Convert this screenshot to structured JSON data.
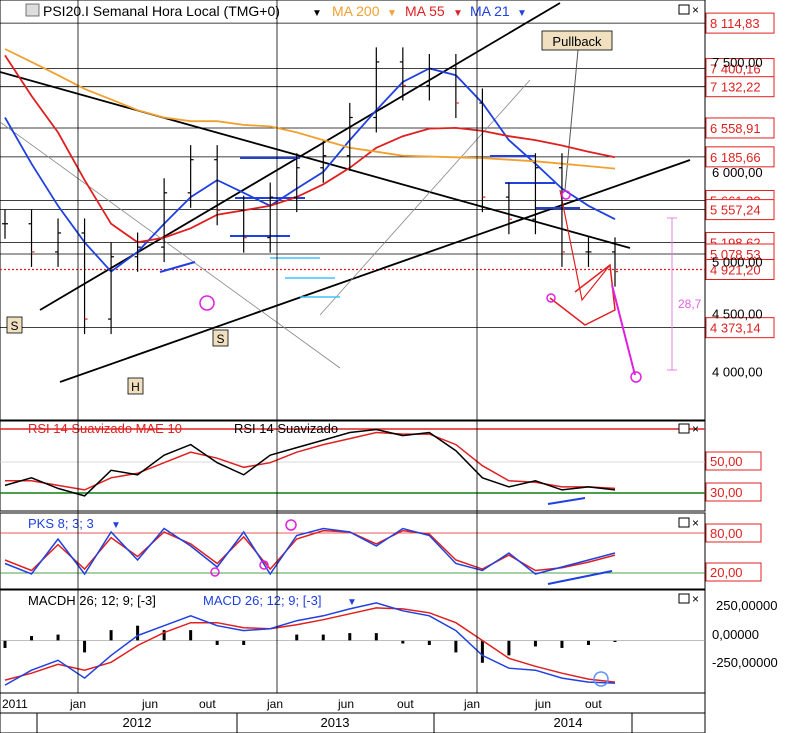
{
  "header": {
    "title": "PSI20.I Semanal Hora Local (TMG+0)",
    "ma200": "MA 200",
    "ma55": "MA 55",
    "ma21": "MA 21",
    "pullback": "Pullback",
    "pattern_labels": [
      "S",
      "S",
      "H"
    ],
    "fib_label": "28,7",
    "colors": {
      "ma200": "#f0a030",
      "ma55": "#e02020",
      "ma21": "#2040e0"
    }
  },
  "price_axis": {
    "ticks": [
      "7 500,00",
      "6 000,00",
      "5 000,00",
      "4 500,00",
      "4 000,00"
    ],
    "boxes": [
      {
        "label": "8 114,83",
        "value": 8114.83
      },
      {
        "label": "7 400,16",
        "value": 7400.16
      },
      {
        "label": "7 132,22",
        "value": 7132.22
      },
      {
        "label": "6 558,91",
        "value": 6558.91
      },
      {
        "label": "6 185,66",
        "value": 6185.66
      },
      {
        "label": "5 661,33",
        "value": 5661.33
      },
      {
        "label": "5 557,24",
        "value": 5557.24
      },
      {
        "label": "5 198,62",
        "value": 5198.62
      },
      {
        "label": "5 078,53",
        "value": 5078.53
      },
      {
        "label": "4 921,20",
        "value": 4921.2
      },
      {
        "label": "4 373,14",
        "value": 4373.14
      }
    ]
  },
  "rsi_panel": {
    "title": "RSI 14 Suavizado MAE 10",
    "title2": "RSI 14 Suavizado",
    "ticks": [
      "50,00",
      "30,00"
    ]
  },
  "pks_panel": {
    "title": "PKS 8; 3; 3",
    "ticks": [
      "80,00",
      "20,00"
    ]
  },
  "macd_panel": {
    "title": "MACDH 26; 12; 9; [-3]",
    "title2": "MACD 26; 12; 9; [-3]",
    "ticks": [
      "250,00000",
      "0,00000",
      "-250,00000"
    ]
  },
  "time_axis": {
    "months": [
      "2011",
      "jan",
      "jun",
      "out",
      "jan",
      "jun",
      "out",
      "jan",
      "jun",
      "out"
    ],
    "years": [
      "2012",
      "2013",
      "2014"
    ]
  },
  "chart_data": {
    "type": "line",
    "x": [
      "2011-10",
      "2012-01",
      "2012-03",
      "2012-06",
      "2012-08",
      "2012-10",
      "2012-12",
      "2013-02",
      "2013-04",
      "2013-06",
      "2013-07",
      "2013-09",
      "2013-11",
      "2014-01",
      "2014-02",
      "2014-03",
      "2014-04",
      "2014-05",
      "2014-06",
      "2014-07",
      "2014-08",
      "2014-09",
      "2014-10",
      "2014-11"
    ],
    "series": [
      {
        "name": "PSI20.I",
        "values": [
          5400,
          5100,
          5300,
          4450,
          5050,
          5150,
          5750,
          6150,
          5550,
          5250,
          5700,
          6050,
          6200,
          6700,
          7500,
          7150,
          7400,
          6900,
          5700,
          5450,
          6050,
          5100,
          5100,
          4900
        ]
      },
      {
        "name": "MA 21",
        "values": [
          6700,
          6100,
          5600,
          5200,
          4900,
          5100,
          5400,
          5700,
          5900,
          5750,
          5600,
          5800,
          6000,
          6400,
          6800,
          7200,
          7400,
          7300,
          6900,
          6400,
          6100,
          5800,
          5600,
          5450
        ]
      },
      {
        "name": "MA 55",
        "values": [
          7600,
          7000,
          6500,
          5900,
          5400,
          5200,
          5250,
          5350,
          5500,
          5550,
          5600,
          5700,
          5850,
          6050,
          6300,
          6450,
          6550,
          6560,
          6520,
          6450,
          6400,
          6330,
          6250,
          6180
        ]
      },
      {
        "name": "MA 200",
        "values": [
          7700,
          7500,
          7300,
          7100,
          6950,
          6800,
          6700,
          6650,
          6650,
          6600,
          6580,
          6500,
          6400,
          6300,
          6250,
          6200,
          6190,
          6180,
          6170,
          6150,
          6130,
          6100,
          6070,
          6040
        ]
      }
    ],
    "ylim": [
      3700,
      8300
    ],
    "indicators": {
      "rsi": [
        35,
        40,
        33,
        28,
        45,
        42,
        55,
        62,
        50,
        42,
        55,
        60,
        65,
        70,
        72,
        68,
        70,
        58,
        40,
        34,
        38,
        32,
        34,
        32
      ],
      "rsi_signal": [
        38,
        38,
        35,
        32,
        40,
        43,
        50,
        57,
        53,
        47,
        50,
        57,
        62,
        66,
        70,
        69,
        69,
        62,
        48,
        38,
        37,
        34,
        34,
        33
      ],
      "rsi_ylim": [
        20,
        75
      ],
      "pks": [
        35,
        20,
        70,
        20,
        80,
        40,
        85,
        60,
        30,
        80,
        20,
        75,
        85,
        80,
        60,
        85,
        75,
        35,
        25,
        50,
        20,
        30,
        40,
        50
      ],
      "pks_signal": [
        40,
        25,
        62,
        27,
        72,
        45,
        80,
        63,
        35,
        73,
        27,
        70,
        82,
        80,
        63,
        82,
        77,
        40,
        27,
        47,
        25,
        29,
        37,
        47
      ],
      "pks_ylim": [
        0,
        100
      ],
      "macd": [
        -450,
        -300,
        -200,
        -380,
        -150,
        50,
        150,
        250,
        150,
        100,
        120,
        200,
        250,
        320,
        380,
        300,
        250,
        100,
        -150,
        -280,
        -300,
        -380,
        -420,
        -430
      ],
      "macd_signal": [
        -400,
        -330,
        -240,
        -300,
        -220,
        -50,
        80,
        180,
        180,
        130,
        120,
        160,
        210,
        270,
        330,
        320,
        280,
        180,
        0,
        -180,
        -260,
        -330,
        -390,
        -420
      ],
      "macd_ylim": [
        -500,
        450
      ]
    }
  }
}
